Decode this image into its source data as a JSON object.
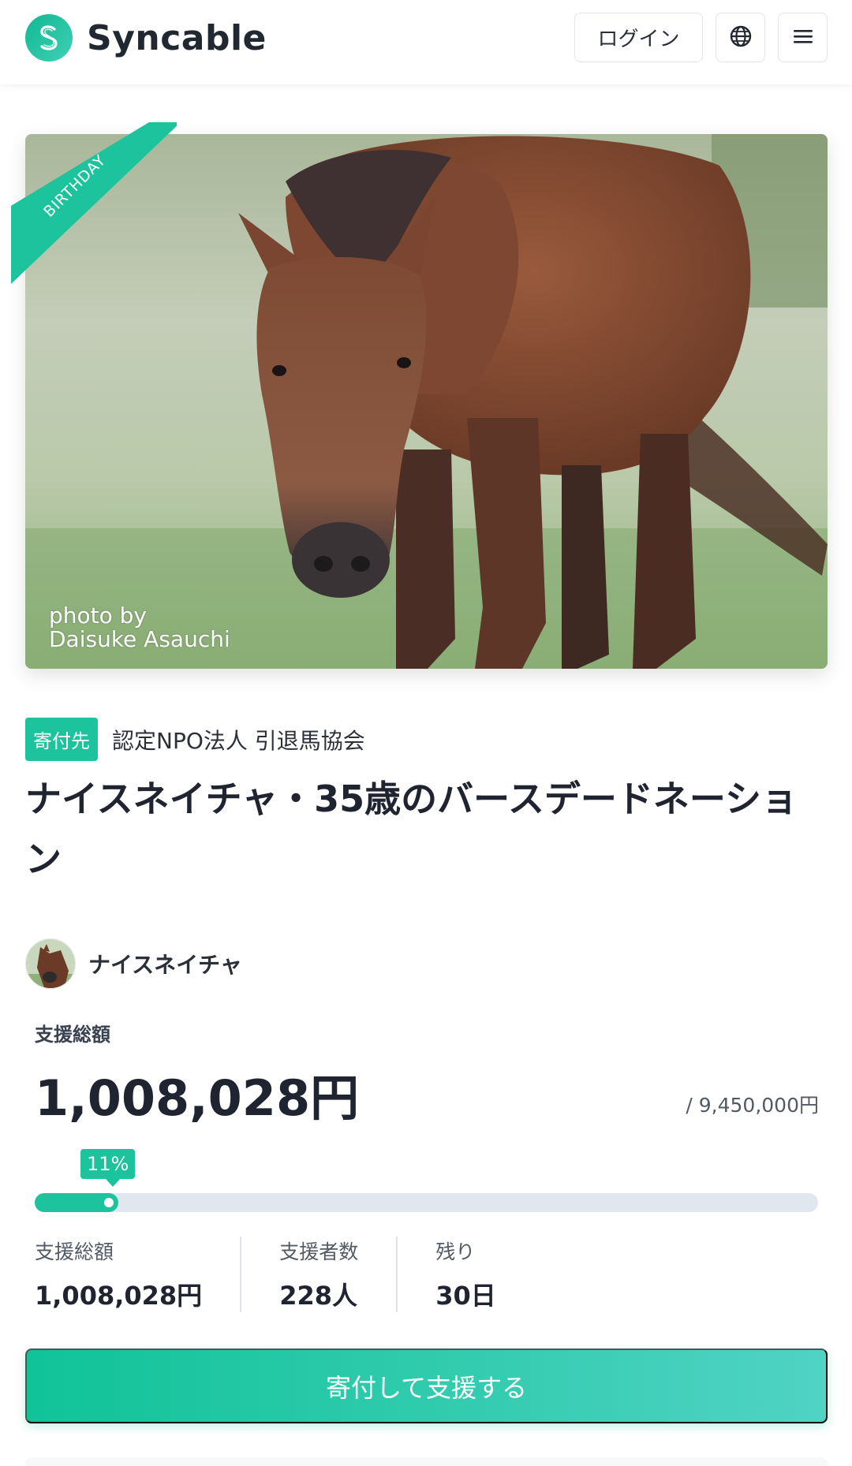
{
  "header": {
    "brand": "Syncable",
    "login_label": "ログイン",
    "globe_icon": "globe-icon",
    "menu_icon": "hamburger-menu-icon"
  },
  "hero": {
    "ribbon": "BIRTHDAY",
    "photo_credit_line1": "photo by",
    "photo_credit_line2": "Daisuke Asauchi"
  },
  "campaign": {
    "recipient_badge": "寄付先",
    "recipient_name": "認定NPO法人 引退馬協会",
    "title": "ナイスネイチャ・35歳のバースデードネーション",
    "owner_name": "ナイスネイチャ"
  },
  "funding": {
    "total_label": "支援総額",
    "total_amount": "1,008,028円",
    "goal": "/ 9,450,000円",
    "progress_label": "11%",
    "progress_fraction": 0.107
  },
  "stats": [
    {
      "label": "支援総額",
      "value": "1,008,028円"
    },
    {
      "label": "支援者数",
      "value": "228人"
    },
    {
      "label": "残り",
      "value": "30日"
    }
  ],
  "cta_label": "寄付して支援する",
  "colors": {
    "accent": "#1cc39c",
    "track": "#e1e7ee"
  }
}
